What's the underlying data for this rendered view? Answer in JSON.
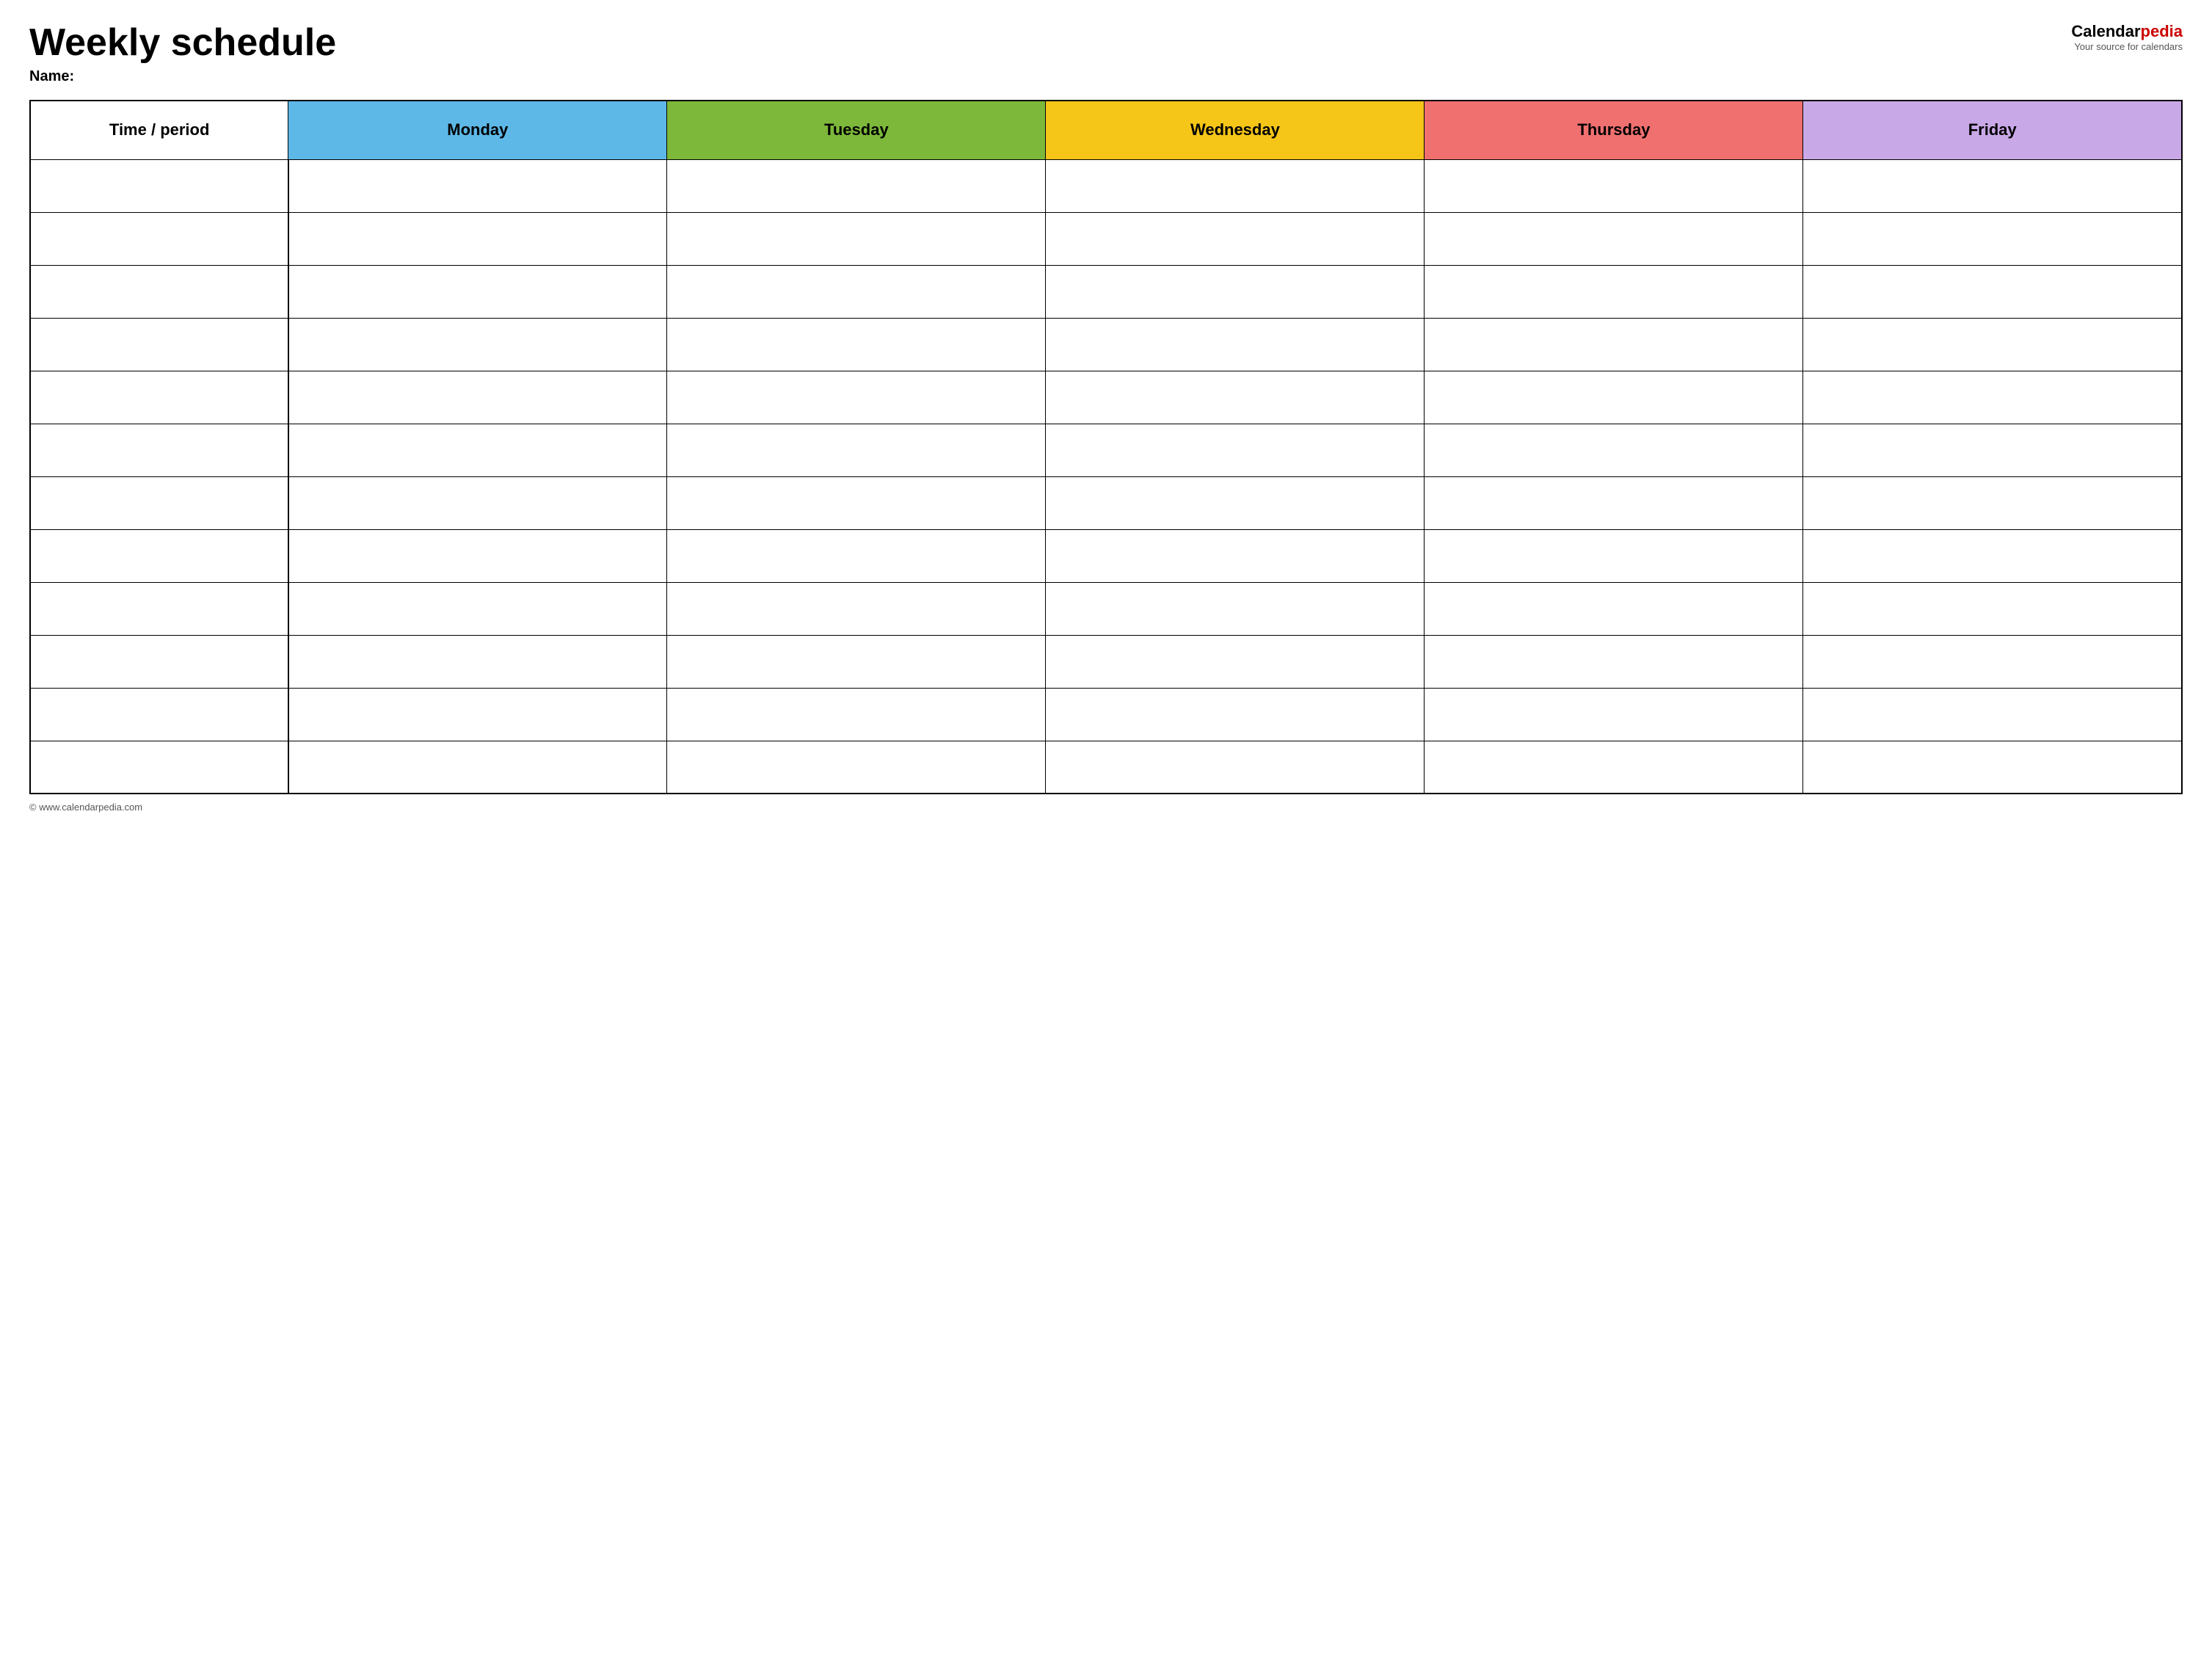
{
  "header": {
    "title": "Weekly schedule",
    "name_label": "Name:",
    "logo_calendar": "Calendar",
    "logo_pedia": "pedia",
    "logo_subtitle": "Your source for calendars"
  },
  "table": {
    "columns": [
      {
        "id": "time",
        "label": "Time / period",
        "color": "#ffffff"
      },
      {
        "id": "monday",
        "label": "Monday",
        "color": "#5db8e8"
      },
      {
        "id": "tuesday",
        "label": "Tuesday",
        "color": "#7db83a"
      },
      {
        "id": "wednesday",
        "label": "Wednesday",
        "color": "#f5c518"
      },
      {
        "id": "thursday",
        "label": "Thursday",
        "color": "#f07070"
      },
      {
        "id": "friday",
        "label": "Friday",
        "color": "#c9a8e8"
      }
    ],
    "row_count": 12
  },
  "footer": {
    "url": "© www.calendarpedia.com"
  }
}
